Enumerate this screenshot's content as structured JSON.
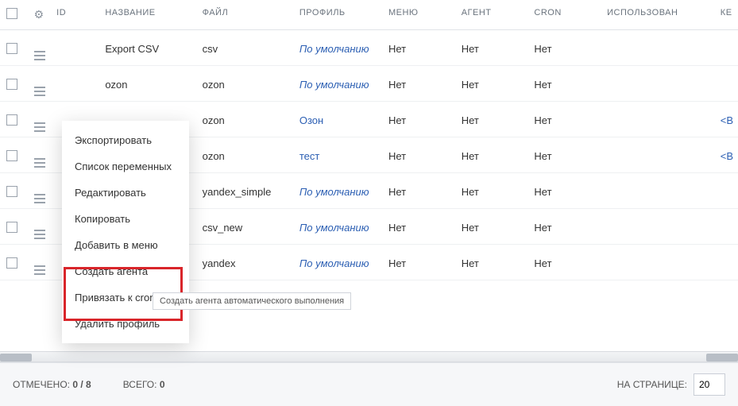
{
  "headers": {
    "id": "ID",
    "name": "НАЗВАНИЕ",
    "file": "ФАЙЛ",
    "profile": "ПРОФИЛЬ",
    "menu": "МЕНЮ",
    "agent": "АГЕНТ",
    "cron": "CRON",
    "used": "ИСПОЛЬЗОВАН",
    "ke": "КЕ"
  },
  "rows": [
    {
      "name": "Export CSV",
      "file": "csv",
      "profile": "По умолчанию",
      "profile_style": "italic",
      "menu": "Нет",
      "agent": "Нет",
      "cron": "Нет",
      "ke": ""
    },
    {
      "name": "ozon",
      "file": "ozon",
      "profile": "По умолчанию",
      "profile_style": "italic",
      "menu": "Нет",
      "agent": "Нет",
      "cron": "Нет",
      "ke": ""
    },
    {
      "name": "",
      "file": "ozon",
      "profile": "Озон",
      "profile_style": "link",
      "menu": "Нет",
      "agent": "Нет",
      "cron": "Нет",
      "ke": "<В"
    },
    {
      "name": "",
      "file": "ozon",
      "profile": "тест",
      "profile_style": "link",
      "menu": "Нет",
      "agent": "Нет",
      "cron": "Нет",
      "ke": "<В"
    },
    {
      "name": "",
      "file": "yandex_simple",
      "profile": "По умолчанию",
      "profile_style": "italic",
      "menu": "Нет",
      "agent": "Нет",
      "cron": "Нет",
      "ke": ""
    },
    {
      "name": "",
      "file": "csv_new",
      "profile": "По умолчанию",
      "profile_style": "italic",
      "menu": "Нет",
      "agent": "Нет",
      "cron": "Нет",
      "ke": ""
    },
    {
      "name": "",
      "file": "yandex",
      "profile": "По умолчанию",
      "profile_style": "italic",
      "menu": "Нет",
      "agent": "Нет",
      "cron": "Нет",
      "ke": ""
    }
  ],
  "context_menu": {
    "items": [
      "Экспортировать",
      "Список переменных",
      "Редактировать",
      "Копировать",
      "Добавить в меню",
      "Создать агента",
      "Привязать к cron",
      "Удалить профиль"
    ]
  },
  "tooltip": "Создать агента автоматического выполнения",
  "footer": {
    "selected_label": "ОТМЕЧЕНО:",
    "selected_value": "0 / 8",
    "total_label": "ВСЕГО:",
    "total_value": "0",
    "perpage_label": "НА СТРАНИЦЕ:",
    "perpage_value": "20"
  }
}
